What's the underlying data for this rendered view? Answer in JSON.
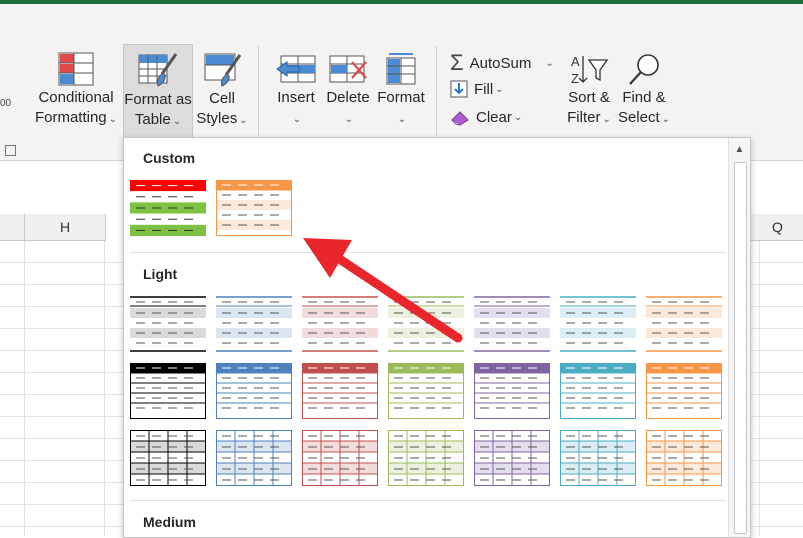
{
  "ribbon": {
    "conditional_formatting": {
      "line1": "Conditional",
      "line2": "Formatting"
    },
    "format_as_table": {
      "line1": "Format as",
      "line2": "Table"
    },
    "cell_styles": {
      "line1": "Cell",
      "line2": "Styles"
    },
    "insert": "Insert",
    "delete": "Delete",
    "format": "Format",
    "autosum": "AutoSum",
    "fill": "Fill",
    "clear": "Clear",
    "sort_filter": {
      "line1": "Sort &",
      "line2": "Filter"
    },
    "find_select": {
      "line1": "Find &",
      "line2": "Select"
    },
    "left_fragment": "00"
  },
  "columns": {
    "left": "H",
    "right": "Q"
  },
  "dropdown": {
    "sections": {
      "custom": "Custom",
      "light": "Light",
      "medium": "Medium"
    }
  },
  "styles": {
    "custom": [
      {
        "kind": "stripe",
        "colors": [
          "#ff0000",
          "#ffffff",
          "#7dc242",
          "#ffffff",
          "#7dc242"
        ]
      },
      {
        "kind": "banded",
        "header": "#f79646",
        "band": "#fde9d9",
        "border": "#f79646"
      }
    ],
    "light_row1": [
      {
        "accent": "#000000",
        "band": "#d9d9d9"
      },
      {
        "accent": "#4f81bd",
        "band": "#dce6f1"
      },
      {
        "accent": "#c0504d",
        "band": "#f2dcdb"
      },
      {
        "accent": "#9bbb59",
        "band": "#ebf1de"
      },
      {
        "accent": "#8064a2",
        "band": "#e4dfec"
      },
      {
        "accent": "#4bacc6",
        "band": "#daeef3"
      },
      {
        "accent": "#f79646",
        "band": "#fde9d9"
      }
    ],
    "light_row2": [
      {
        "accent": "#000000"
      },
      {
        "accent": "#4f81bd"
      },
      {
        "accent": "#c0504d"
      },
      {
        "accent": "#9bbb59"
      },
      {
        "accent": "#8064a2"
      },
      {
        "accent": "#4bacc6"
      },
      {
        "accent": "#f79646"
      }
    ],
    "light_row3": [
      {
        "accent": "#000000",
        "band": "#d9d9d9"
      },
      {
        "accent": "#4f81bd",
        "band": "#dce6f1"
      },
      {
        "accent": "#c0504d",
        "band": "#f2dcdb"
      },
      {
        "accent": "#9bbb59",
        "band": "#ebf1de"
      },
      {
        "accent": "#8064a2",
        "band": "#e4dfec"
      },
      {
        "accent": "#4bacc6",
        "band": "#daeef3"
      },
      {
        "accent": "#f79646",
        "band": "#fde9d9"
      }
    ]
  },
  "colors": {
    "arrow": "#e8262b",
    "excel_green": "#1e6e42"
  }
}
